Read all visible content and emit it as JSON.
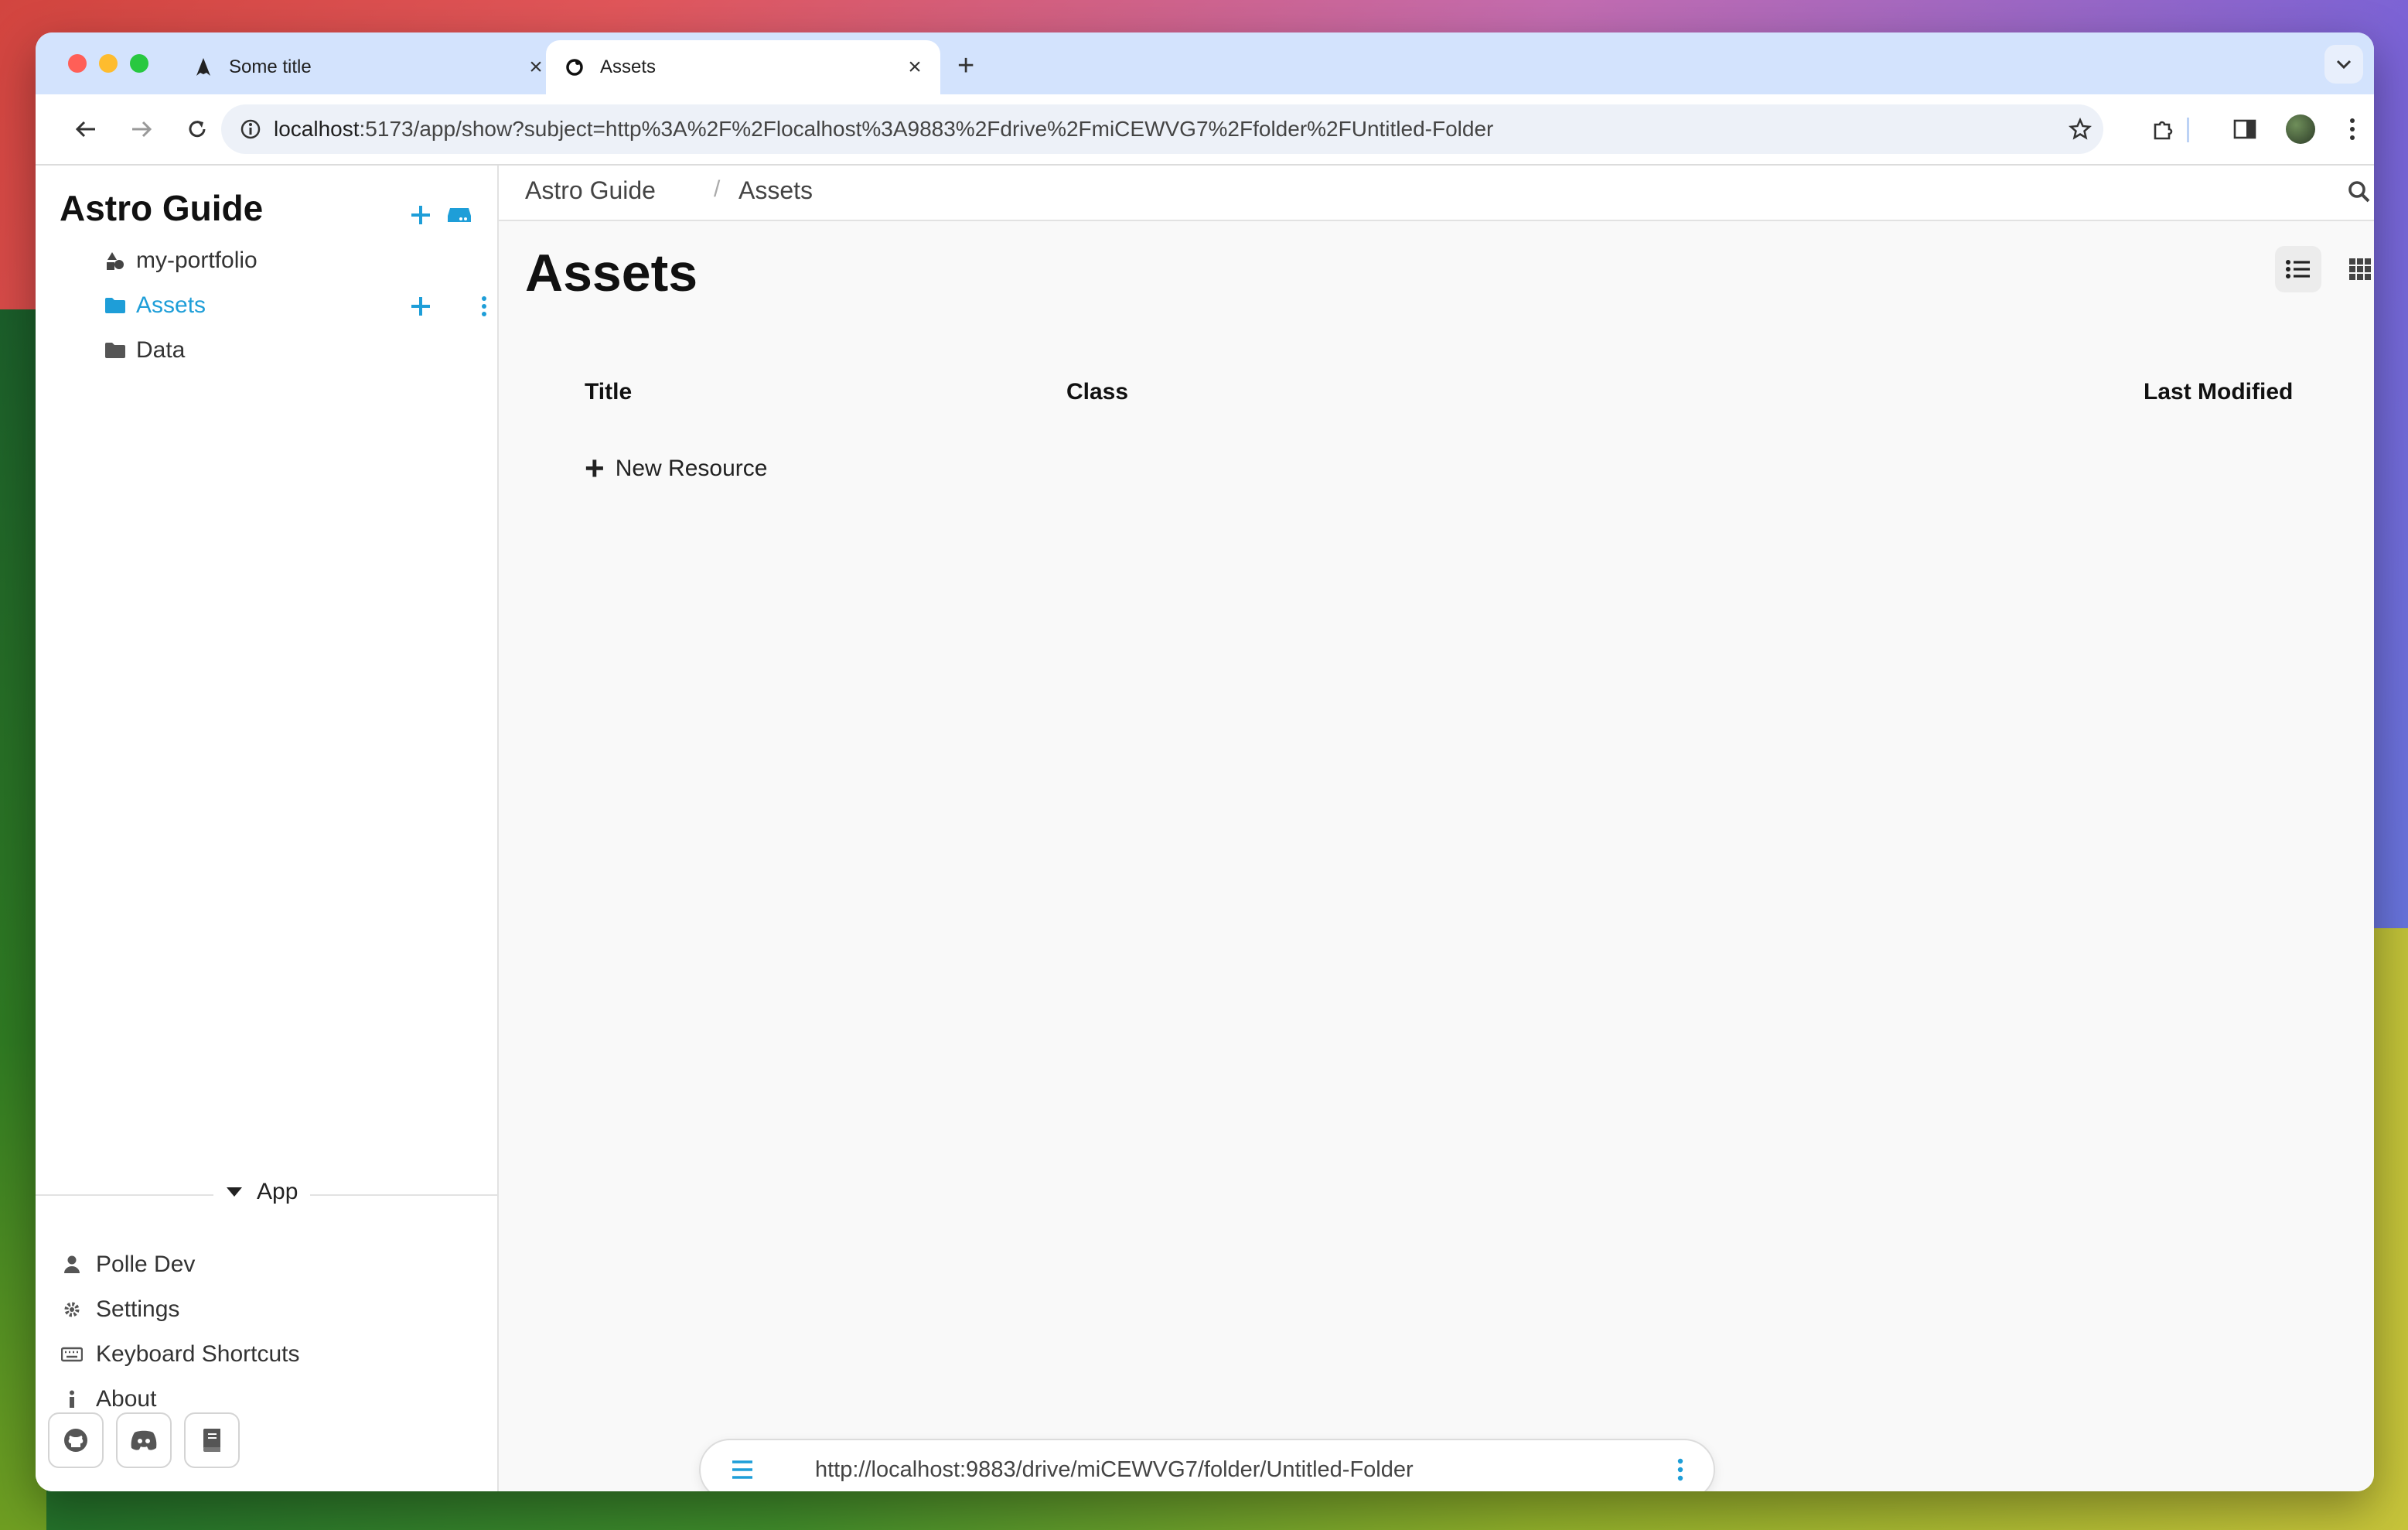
{
  "browser": {
    "tabs": [
      {
        "label": "Some title",
        "icon": "astro-logo-icon"
      },
      {
        "label": "Assets",
        "icon": "atomic-logo-icon",
        "active": true
      }
    ],
    "url_host": "localhost",
    "url_rest": ":5173/app/show?subject=http%3A%2F%2Flocalhost%3A9883%2Fdrive%2FmiCEWVG7%2Ffolder%2FUntitled-Folder"
  },
  "sidebar": {
    "drive_title": "Astro Guide",
    "items": [
      {
        "label": "my-portfolio",
        "icon": "shapes-icon"
      },
      {
        "label": "Assets",
        "icon": "folder-icon",
        "active": true
      },
      {
        "label": "Data",
        "icon": "folder-icon"
      }
    ],
    "app_section": {
      "toggle_label": "App",
      "items": [
        {
          "label": "Polle Dev",
          "icon": "user-icon"
        },
        {
          "label": "Settings",
          "icon": "gear-icon"
        },
        {
          "label": "Keyboard Shortcuts",
          "icon": "keyboard-icon"
        },
        {
          "label": "About",
          "icon": "info-icon"
        }
      ]
    },
    "footer_links": [
      "github-icon",
      "discord-icon",
      "book-icon"
    ]
  },
  "main": {
    "breadcrumb": [
      "Astro Guide",
      "Assets"
    ],
    "title": "Assets",
    "columns": [
      "Title",
      "Class",
      "Last Modified"
    ],
    "new_resource_label": "New Resource",
    "subject_url": "http://localhost:9883/drive/miCEWVG7/folder/Untitled-Folder"
  },
  "colors": {
    "accent": "#1e9ed8",
    "tabbar": "#d3e3fd"
  }
}
